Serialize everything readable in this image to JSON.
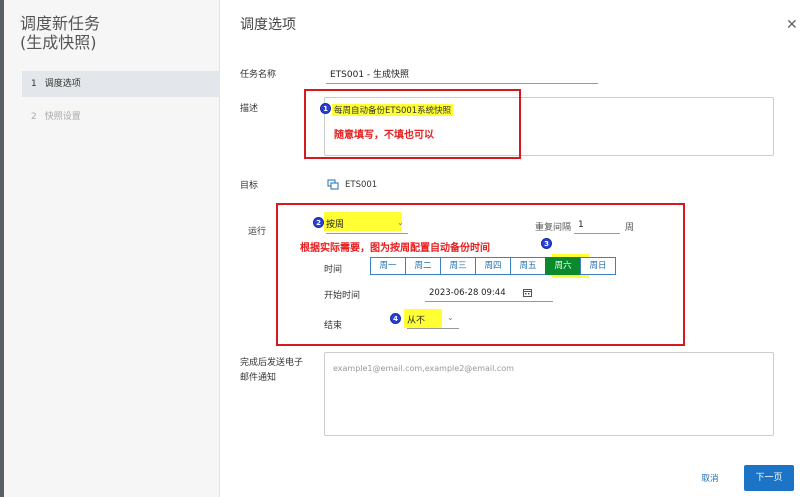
{
  "sidebar": {
    "title": "调度新任务\n(生成快照)",
    "steps": [
      {
        "num": "1",
        "label": "调度选项"
      },
      {
        "num": "2",
        "label": "快照设置"
      }
    ]
  },
  "main": {
    "title": "调度选项",
    "task_name_label": "任务名称",
    "task_name_value": "ETS001 - 生成快照",
    "description_label": "描述",
    "description_value": "每周自动备份ETS001系统快照",
    "target_label": "目标",
    "target_value": "ETS001",
    "run_label": "运行",
    "run_value": "按周",
    "repeat_label": "重复间隔",
    "repeat_value": "1",
    "repeat_unit": "周",
    "time_label": "时间",
    "days": [
      "周一",
      "周二",
      "周三",
      "周四",
      "周五",
      "周六",
      "周日"
    ],
    "selected_day": "周六",
    "start_time_label": "开始时间",
    "start_time_value": "2023-06-28 09:44",
    "end_label": "结束",
    "end_value": "从不",
    "email_label": "完成后发送电子邮件通知",
    "email_placeholder": "example1@email.com,example2@email.com",
    "cancel_label": "取消",
    "next_label": "下一页"
  },
  "annotations": {
    "n1": "1",
    "n2": "2",
    "n3": "3",
    "n4": "4",
    "note_description": "随意填写，不填也可以",
    "note_run": "根据实际需要，图为按周配置自动备份时间",
    "box_color": "#d7191f",
    "highlight_color": "#ffff33",
    "circle_color": "#2a3fd6"
  }
}
